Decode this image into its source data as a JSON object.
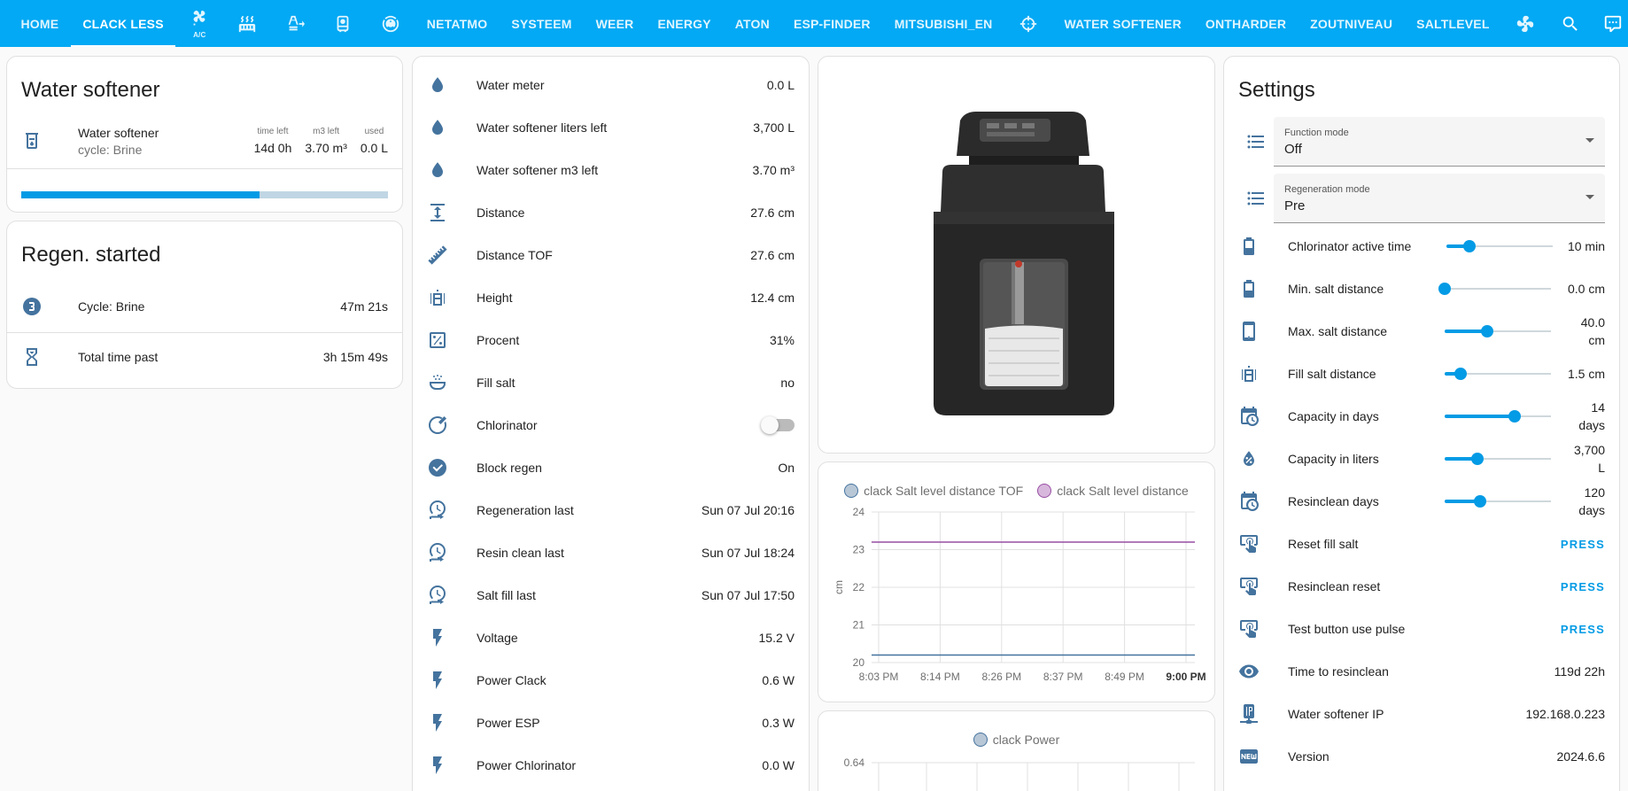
{
  "header": {
    "tabs": [
      {
        "label": "HOME"
      },
      {
        "label": "CLACK LESS",
        "active": true
      },
      {
        "icon": "air-conditioner-icon",
        "sub": "A/C"
      },
      {
        "icon": "radiator-icon"
      },
      {
        "icon": "transmission-tower-export-icon"
      },
      {
        "icon": "water-boiler-icon"
      },
      {
        "icon": "robot-vacuum-icon"
      },
      {
        "label": "NETATMO"
      },
      {
        "label": "SYSTEEM"
      },
      {
        "label": "WEER"
      },
      {
        "label": "ENERGY"
      },
      {
        "label": "ATON"
      },
      {
        "label": "ESP-FINDER"
      },
      {
        "label": "MITSUBISHI_EN"
      },
      {
        "icon": "target-icon"
      },
      {
        "label": "WATER SOFTENER"
      },
      {
        "label": "ONTHARDER"
      },
      {
        "label": "ZOUTNIVEAU"
      },
      {
        "label": "SALTLEVEL"
      },
      {
        "icon": "fan-icon"
      }
    ]
  },
  "water_softener_card": {
    "title": "Water softener",
    "entity_name": "Water softener",
    "entity_state": "cycle: Brine",
    "stats": [
      {
        "label": "time left",
        "value": "14d 0h"
      },
      {
        "label": "m3 left",
        "value": "3.70 m³"
      },
      {
        "label": "used",
        "value": "0.0 L"
      }
    ],
    "progress_fraction": 0.65
  },
  "regen_card": {
    "title": "Regen. started",
    "rows": [
      {
        "label": "Cycle: Brine",
        "value": "47m 21s",
        "icon": "numeric-3-circle-icon"
      },
      {
        "label": "Total time past",
        "value": "3h 15m 49s",
        "icon": "timer-sand-icon"
      }
    ]
  },
  "entities_card": {
    "rows": [
      {
        "label": "Water meter",
        "value": "0.0 L",
        "icon": "water-icon"
      },
      {
        "label": "Water softener liters left",
        "value": "3,700 L",
        "icon": "water-icon"
      },
      {
        "label": "Water softener m3 left",
        "value": "3.70 m³",
        "icon": "water-icon"
      },
      {
        "label": "Distance",
        "value": "27.6 cm",
        "icon": "arrow-expand-vertical-icon"
      },
      {
        "label": "Distance TOF",
        "value": "27.6 cm",
        "icon": "ruler-icon"
      },
      {
        "label": "Height",
        "value": "12.4 cm",
        "icon": "storage-tank-icon"
      },
      {
        "label": "Procent",
        "value": "31%",
        "icon": "percent-box-icon"
      },
      {
        "label": "Fill salt",
        "value": "no",
        "icon": "shaker-icon"
      },
      {
        "label": "Chlorinator",
        "value": "",
        "icon": "electric-switch-icon",
        "toggle": true,
        "toggle_on": false
      },
      {
        "label": "Block regen",
        "value": "On",
        "icon": "check-circle-icon"
      },
      {
        "label": "Regeneration last",
        "value": "Sun 07 Jul 20:16",
        "icon": "clock-end-icon"
      },
      {
        "label": "Resin clean last",
        "value": "Sun 07 Jul 18:24",
        "icon": "clock-end-icon"
      },
      {
        "label": "Salt fill last",
        "value": "Sun 07 Jul 17:50",
        "icon": "clock-end-icon"
      },
      {
        "label": "Voltage",
        "value": "15.2 V",
        "icon": "flash-icon"
      },
      {
        "label": "Power Clack",
        "value": "0.6 W",
        "icon": "flash-icon"
      },
      {
        "label": "Power ESP",
        "value": "0.3 W",
        "icon": "flash-icon"
      },
      {
        "label": "Power Chlorinator",
        "value": "0.0 W",
        "icon": "flash-icon"
      }
    ]
  },
  "chart_data": [
    {
      "type": "line",
      "ylabel": "cm",
      "ylim": [
        20,
        24
      ],
      "yticks": [
        "24",
        "23",
        "22",
        "21",
        "20"
      ],
      "xticks": [
        "8:03 PM",
        "8:14 PM",
        "8:26 PM",
        "8:37 PM",
        "8:49 PM",
        "9:00 PM"
      ],
      "legend_position": "top",
      "series": [
        {
          "name": "clack Salt level distance TOF",
          "color": "#44739e",
          "fill": "#b8c7d6",
          "values": [
            20.2,
            20.2,
            20.2,
            20.2,
            20.2,
            20.2
          ]
        },
        {
          "name": "clack Salt level distance",
          "color": "#984ea3",
          "fill": "#d8b7dd",
          "values": [
            23.2,
            23.2,
            23.2,
            23.2,
            23.2,
            23.2
          ]
        }
      ]
    },
    {
      "type": "line",
      "yticks": [
        "0.64"
      ],
      "legend_position": "top",
      "series": [
        {
          "name": "clack Power",
          "color": "#44739e",
          "fill": "#b8c7d6",
          "values": []
        }
      ]
    }
  ],
  "settings_card": {
    "title": "Settings",
    "selects": [
      {
        "label": "Function mode",
        "value": "Off",
        "icon": "format-list-bulleted-icon"
      },
      {
        "label": "Regeneration mode",
        "value": "Pre",
        "icon": "format-list-bulleted-icon"
      }
    ],
    "sliders": [
      {
        "label": "Chlorinator active time",
        "value_text": "10 min",
        "icon": "battery-icon",
        "fraction": 0.22
      },
      {
        "label": "Min. salt distance",
        "value_text": "0.0 cm",
        "icon": "battery-icon",
        "fraction": 0.0
      },
      {
        "label": "Max. salt distance",
        "value_text": "40.0 cm",
        "icon": "cellphone-icon",
        "fraction": 0.4
      },
      {
        "label": "Fill salt distance",
        "value_text": "1.5 cm",
        "icon": "storage-tank-icon",
        "fraction": 0.15
      },
      {
        "label": "Capacity in days",
        "value_text": "14 days",
        "icon": "calendar-clock-icon",
        "fraction": 0.66
      },
      {
        "label": "Capacity in liters",
        "value_text": "3,700 L",
        "icon": "water-percent-icon",
        "fraction": 0.31
      },
      {
        "label": "Resinclean days",
        "value_text": "120 days",
        "icon": "calendar-clock-icon",
        "fraction": 0.33
      }
    ],
    "buttons": [
      {
        "label": "Reset fill salt",
        "action": "PRESS",
        "icon": "gesture-tap-button-icon"
      },
      {
        "label": "Resinclean reset",
        "action": "PRESS",
        "icon": "gesture-tap-button-icon"
      },
      {
        "label": "Test button use pulse",
        "action": "PRESS",
        "icon": "gesture-tap-button-icon"
      }
    ],
    "info": [
      {
        "label": "Time to resinclean",
        "value": "119d 22h",
        "icon": "eye-icon"
      },
      {
        "label": "Water softener IP",
        "value": "192.168.0.223",
        "icon": "ip-network-icon"
      },
      {
        "label": "Version",
        "value": "2024.6.6",
        "icon": "new-box-icon"
      }
    ]
  }
}
